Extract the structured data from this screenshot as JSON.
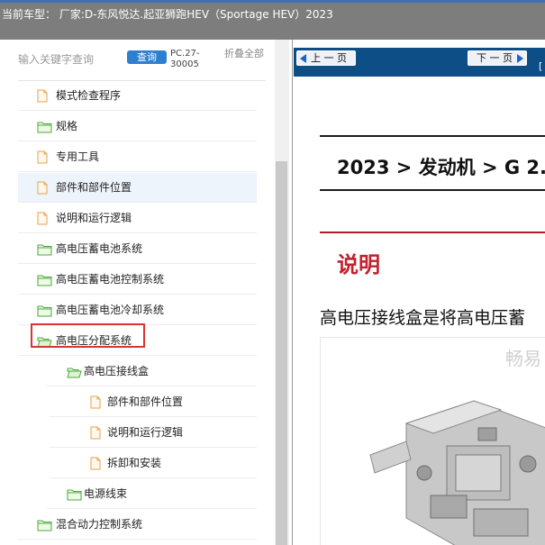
{
  "topbar": {
    "vehicle_text": "当前车型： 厂家:D-东风悦达.起亚狮跑HEV（Sportage HEV）2023"
  },
  "sidebar": {
    "search_placeholder": "输入关键字查询",
    "search_button": "查询",
    "pc_code": "PC.27-30005",
    "collapse_all": "折叠全部",
    "items": [
      {
        "label": "模式检查程序",
        "icon": "document-icon",
        "level": 0
      },
      {
        "label": "规格",
        "icon": "folder-icon",
        "level": 0
      },
      {
        "label": "专用工具",
        "icon": "document-icon",
        "level": 0
      },
      {
        "label": "部件和部件位置",
        "icon": "document-icon",
        "level": 0
      },
      {
        "label": "说明和运行逻辑",
        "icon": "document-icon",
        "level": 0
      },
      {
        "label": "高电压蓄电池系统",
        "icon": "folder-icon",
        "level": 0
      },
      {
        "label": "高电压蓄电池控制系统",
        "icon": "folder-icon",
        "level": 0
      },
      {
        "label": "高电压蓄电池冷却系统",
        "icon": "folder-icon",
        "level": 0
      },
      {
        "label": "高电压分配系统",
        "icon": "folder-open-icon",
        "level": 0
      },
      {
        "label": "高电压接线盒",
        "icon": "folder-open-icon",
        "level": 1
      },
      {
        "label": "部件和部件位置",
        "icon": "document-icon",
        "level": 2
      },
      {
        "label": "说明和运行逻辑",
        "icon": "document-icon",
        "level": 2
      },
      {
        "label": "拆卸和安装",
        "icon": "document-icon",
        "level": 2
      },
      {
        "label": "电源线束",
        "icon": "folder-icon",
        "level": 1
      },
      {
        "label": "混合动力控制系统",
        "icon": "folder-icon",
        "level": 0
      }
    ]
  },
  "content": {
    "prev_button": "上 一 页",
    "next_button": "下 一 页",
    "nav_extra": "[",
    "breadcrumb": "2023 > 发动机 > G 2.",
    "section_title": "说明",
    "description": "高电压接线盒是将高电压蓄",
    "watermark": "畅易"
  },
  "colors": {
    "accent": "#2e7fcf",
    "nav_bar": "#0d4e86",
    "section_red": "#c2212f",
    "highlight_box": "#d93434"
  }
}
